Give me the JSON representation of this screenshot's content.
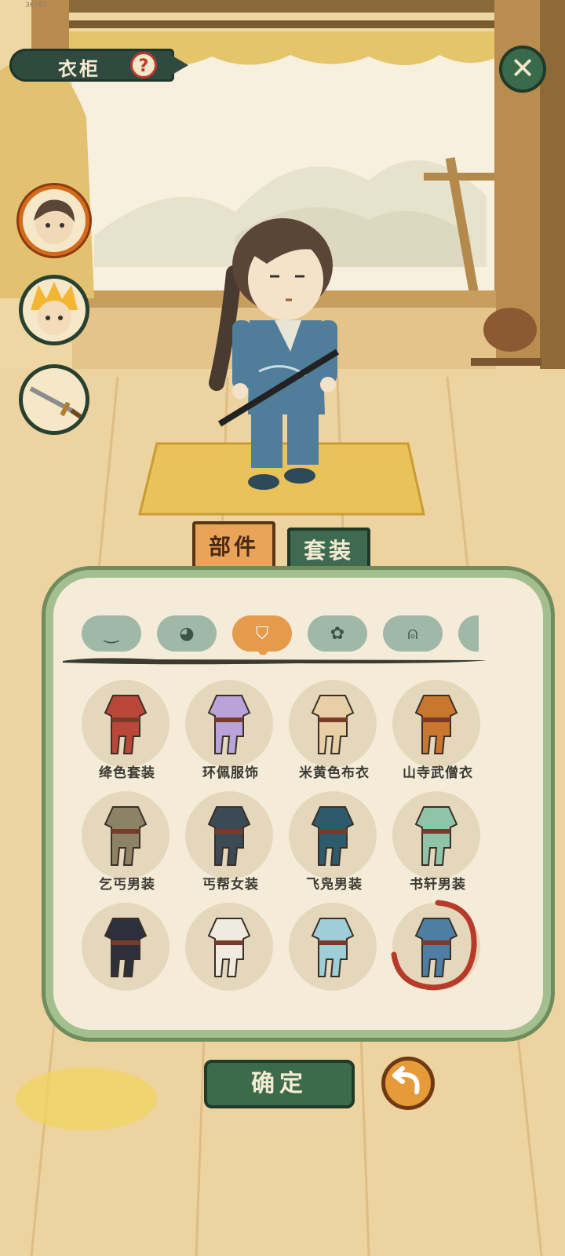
{
  "status_bar": {
    "text": "36767"
  },
  "header": {
    "title": "衣柜",
    "help_icon": "question-mark-icon",
    "help_glyph": "?",
    "close_icon": "close-icon",
    "close_glyph": "✕"
  },
  "side_buttons": [
    {
      "name": "character-portrait",
      "selected": true
    },
    {
      "name": "companion-portrait",
      "selected": false
    },
    {
      "name": "weapon-sword",
      "selected": false
    }
  ],
  "tabs": {
    "parts": "部件",
    "sets": "套装",
    "active": "parts"
  },
  "categories": [
    {
      "icon": "face-icon",
      "glyph": "‿"
    },
    {
      "icon": "hair-icon",
      "glyph": "◕"
    },
    {
      "icon": "clothing-icon",
      "glyph": "⛉",
      "selected": true
    },
    {
      "icon": "flower-accessory-icon",
      "glyph": "✿"
    },
    {
      "icon": "shoes-icon",
      "glyph": "⍝"
    },
    {
      "icon": "more-icon",
      "glyph": "◐"
    }
  ],
  "outfits": [
    {
      "label": "绛色套装",
      "color": "#b9473a"
    },
    {
      "label": "环佩服饰",
      "color": "#b8a4d8"
    },
    {
      "label": "米黄色布衣",
      "color": "#e8cfa6"
    },
    {
      "label": "山寺武僧衣",
      "color": "#c9772f"
    },
    {
      "label": "乞丐男装",
      "color": "#8c8266"
    },
    {
      "label": "丐帮女装",
      "color": "#3b4a55"
    },
    {
      "label": "飞凫男装",
      "color": "#2e5a6b"
    },
    {
      "label": "书轩男装",
      "color": "#8fc4a9"
    },
    {
      "label": "",
      "color": "#2d2f3a"
    },
    {
      "label": "",
      "color": "#f0eadf"
    },
    {
      "label": "",
      "color": "#9ecfd8"
    },
    {
      "label": "",
      "color": "#4e7fa3",
      "equipped": true
    }
  ],
  "footer": {
    "confirm": "确定",
    "back_icon": "undo-arrow-icon"
  },
  "colors": {
    "accent": "#e59a4c",
    "dark_green": "#3c6b4b",
    "panel_border": "#a4bf8e"
  }
}
